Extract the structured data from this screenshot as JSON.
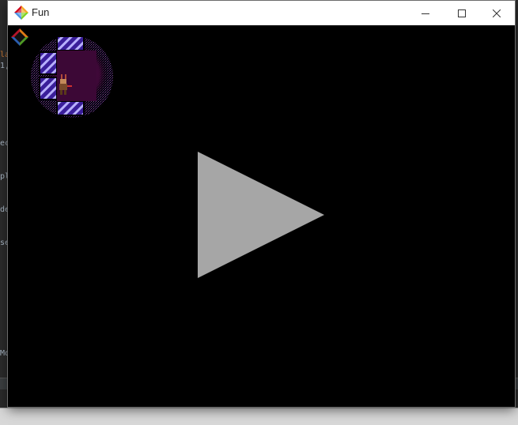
{
  "window": {
    "title": "Fun",
    "controls": {
      "minimize": "minimize",
      "maximize": "maximize",
      "close": "close"
    }
  },
  "ide_background": {
    "fragments": [
      "la",
      "1,",
      "ec",
      "pl",
      "de",
      "se",
      "Mo"
    ]
  },
  "game": {
    "overlay": "play-triangle",
    "colors": {
      "background": "#000000",
      "play_triangle": "#a6a6a6",
      "fog": "#5a0a4e",
      "wall": "#3a1e9a",
      "wall_highlight": "#b8b0ff"
    }
  }
}
